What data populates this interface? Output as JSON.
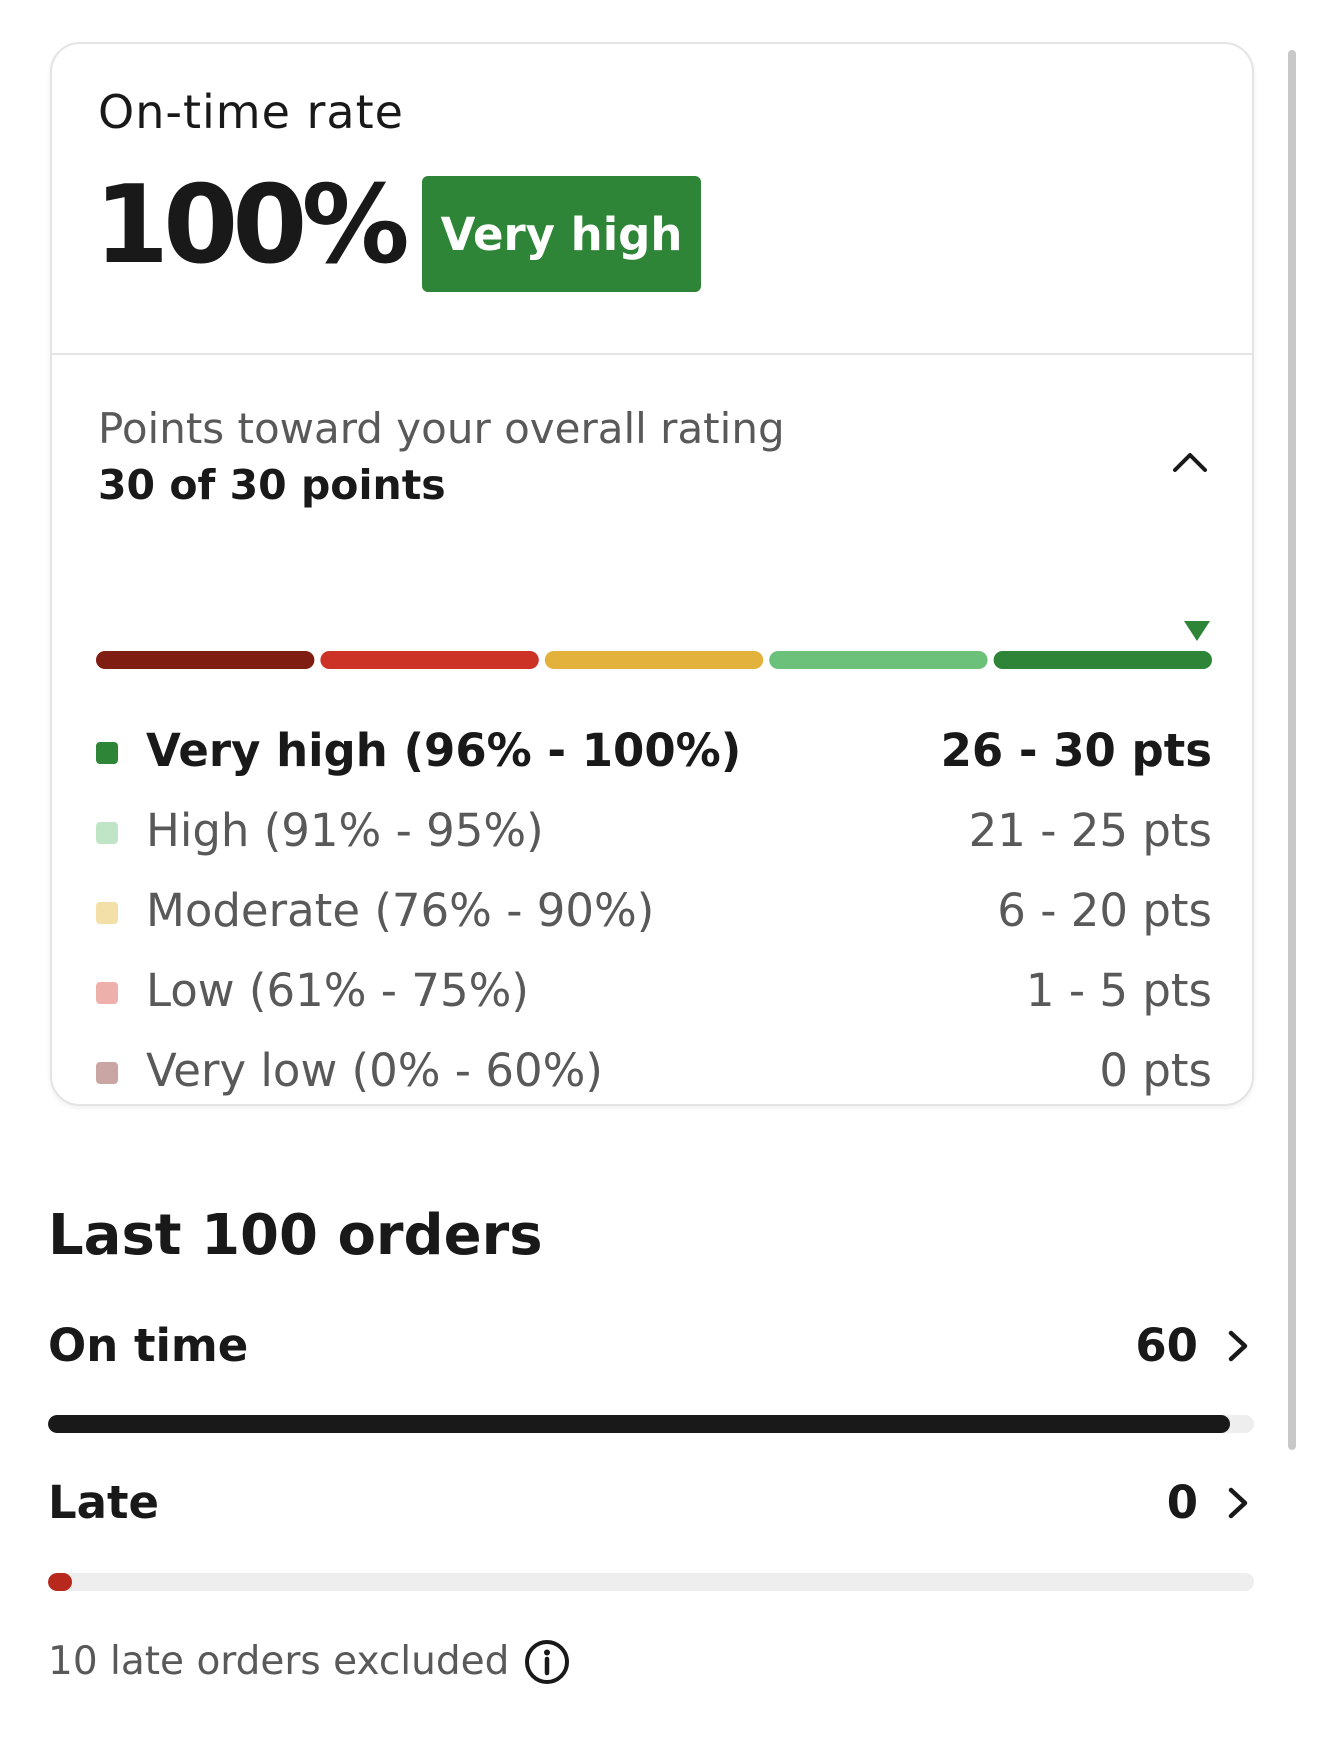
{
  "metric": {
    "title": "On-time rate",
    "value": "100%",
    "badge": "Very high",
    "badge_color": "#2f8537"
  },
  "points": {
    "heading": "Points toward your overall rating",
    "value": "30 of 30 points",
    "expanded": true,
    "collapse_icon": "chevron-up-icon",
    "marker_icon": "triangle-down-icon",
    "marker_color": "#2f8537",
    "current_rate_percent": 100
  },
  "scale_colors": [
    "#7f1d12",
    "#cc3226",
    "#e3b23c",
    "#6cc17a",
    "#2f8537"
  ],
  "tiers": [
    {
      "label": "Very high (96% - 100%)",
      "points": "26 - 30 pts",
      "color": "#2f8537",
      "active": true
    },
    {
      "label": "High (91% - 95%)",
      "points": "21 - 25 pts",
      "color": "#bfe4c6",
      "active": false
    },
    {
      "label": "Moderate (76% - 90%)",
      "points": "6 - 20 pts",
      "color": "#f2e0a8",
      "active": false
    },
    {
      "label": "Low (61% - 75%)",
      "points": "1 - 5 pts",
      "color": "#eeb0aa",
      "active": false
    },
    {
      "label": "Very low (0% - 60%)",
      "points": "0 pts",
      "color": "#c9a6a3",
      "active": false
    }
  ],
  "orders": {
    "heading": "Last 100 orders",
    "rows": [
      {
        "label": "On time",
        "count": "60",
        "fill_fraction": 0.98,
        "fill_color": "#191919",
        "chevron_icon": "chevron-right-icon"
      },
      {
        "label": "Late",
        "count": "0",
        "fill_fraction": 0.02,
        "fill_color": "#b9281c",
        "chevron_icon": "chevron-right-icon"
      }
    ],
    "footnote": "10 late orders excluded",
    "footnote_icon": "info-icon"
  }
}
